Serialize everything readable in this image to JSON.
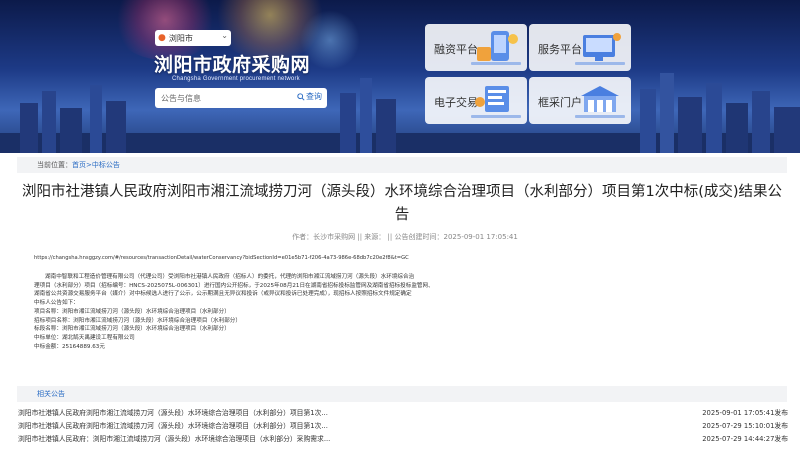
{
  "header": {
    "location": "浏阳市",
    "site_title": "浏阳市政府采购网",
    "site_subtitle": "Changsha Government procurement network",
    "search": {
      "placeholder": "公告与信息",
      "button_label": "查询"
    },
    "platforms": [
      {
        "label": "融资平台",
        "icon": "finance-illustration"
      },
      {
        "label": "服务平台",
        "icon": "service-illustration"
      },
      {
        "label": "电子交易",
        "icon": "e-trade-illustration"
      },
      {
        "label": "框采门户",
        "icon": "framework-portal-illustration"
      }
    ]
  },
  "breadcrumb": {
    "label": "当前位置：",
    "items": [
      "首页",
      "中标公告"
    ],
    "separator": ">"
  },
  "article": {
    "title": "浏阳市社港镇人民政府浏阳市湘江流域捞刀河（源头段）水环境综合治理项目（水利部分）项目第1次中标(成交)结果公告",
    "meta": {
      "author_label": "作者：",
      "author": "长沙市采购网",
      "source_label": "|| 来源：",
      "source": "",
      "created_label": "|| 公告创建时间：",
      "created": "2025-09-01 17:05:41"
    },
    "url": "https://changsha.hnsggzy.com/#/resources/transactionDetail/waterConservancy?bidSectionId=e01e5b71-f206-4a73-986e-68db7c20e2f8&t=GC",
    "body": {
      "intro_lines": [
        "湖南中智联和工程造价管理有限公司（代理公司）受浏阳市社港镇人民政府（招标人）的委托，代理的浏阳市湘江流域捞刀河（源头段）水环境综合治",
        "理项目（水利部分）项目（招标编号：HNCS-2025075L-006301）进行国内公开招标，于2025年08月21日在湖南省招标投标监管网及湖南省招标投标监管网、",
        "湖南省公共资源交易服务平台（媒介）对中标候选人进行了公示，公示期满且无异议和投诉（或异议和投诉已处理完成），现招标人按照招标文件规定确定",
        "中标人公告如下："
      ],
      "fields": [
        {
          "label": "项目名称：",
          "value": "浏阳市湘江流域捞刀河（源头段）水环境综合治理项目（水利部分）"
        },
        {
          "label": "招标项目名称：",
          "value": "浏阳市湘江流域捞刀河（源头段）水环境综合治理项目（水利部分）"
        },
        {
          "label": "标段名称：",
          "value": "浏阳市湘江流域捞刀河（源头段）水环境综合治理项目（水利部分）"
        },
        {
          "label": "中标单位：",
          "value": "湖北鹄天禹建设工程有限公司"
        },
        {
          "label": "中标金额：",
          "value": "25164889.63元"
        }
      ]
    }
  },
  "related": {
    "header": "相关公告",
    "items": [
      {
        "title": "浏阳市社港镇人民政府浏阳市湘江流域捞刀河（源头段）水环境综合治理项目（水利部分）项目第1次...",
        "date": "2025-09-01 17:05:41发布"
      },
      {
        "title": "浏阳市社港镇人民政府浏阳市湘江流域捞刀河（源头段）水环境综合治理项目（水利部分）项目第1次...",
        "date": "2025-07-29 15:10:01发布"
      },
      {
        "title": "浏阳市社港镇人民政府：浏阳市湘江流域捞刀河（源头段）水环境综合治理项目（水利部分）采购需求...",
        "date": "2025-07-29 14:44:27发布"
      }
    ]
  }
}
